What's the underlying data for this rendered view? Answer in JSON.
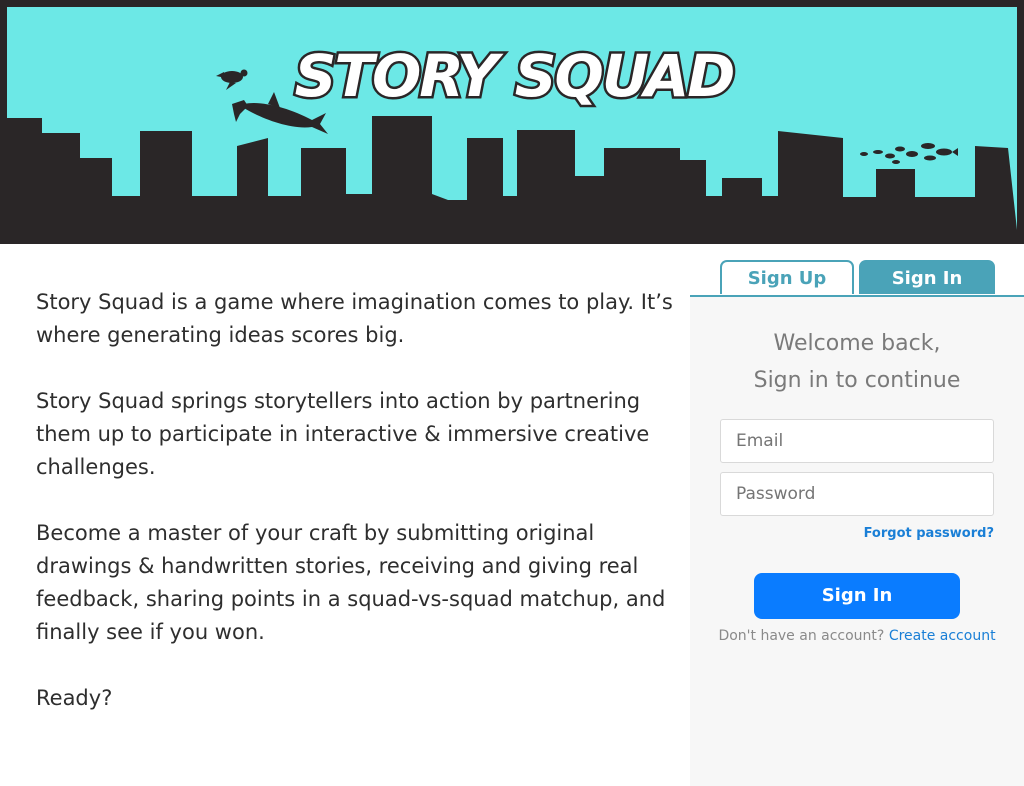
{
  "banner": {
    "logo_text": "STORY SQUAD",
    "colors": {
      "sky": "#6ce8e6",
      "silhouette": "#2a2627",
      "frame": "#2a2627"
    }
  },
  "intro": {
    "paragraphs": [
      "Story Squad is a game where imagination comes to play. It’s where generating ideas scores big.",
      "Story Squad springs storytellers into action by partnering them up to participate in interactive & immersive creative challenges.",
      "Become a master of your craft by submitting original drawings & handwritten stories, receiving and giving real feedback, sharing points in a squad-vs-squad matchup, and finally see if you won.",
      "Ready?"
    ]
  },
  "auth": {
    "tabs": [
      {
        "label": "Sign Up",
        "active": false
      },
      {
        "label": "Sign In",
        "active": true
      }
    ],
    "welcome_line1": "Welcome back,",
    "welcome_line2": "Sign in to continue",
    "email_placeholder": "Email",
    "password_placeholder": "Password",
    "forgot_label": "Forgot password?",
    "submit_label": "Sign In",
    "no_account_text": "Don't have an account?",
    "create_account_label": "Create account",
    "colors": {
      "accent": "#4aa3b8",
      "button": "#0a7cff",
      "link": "#1a7fd6"
    }
  }
}
